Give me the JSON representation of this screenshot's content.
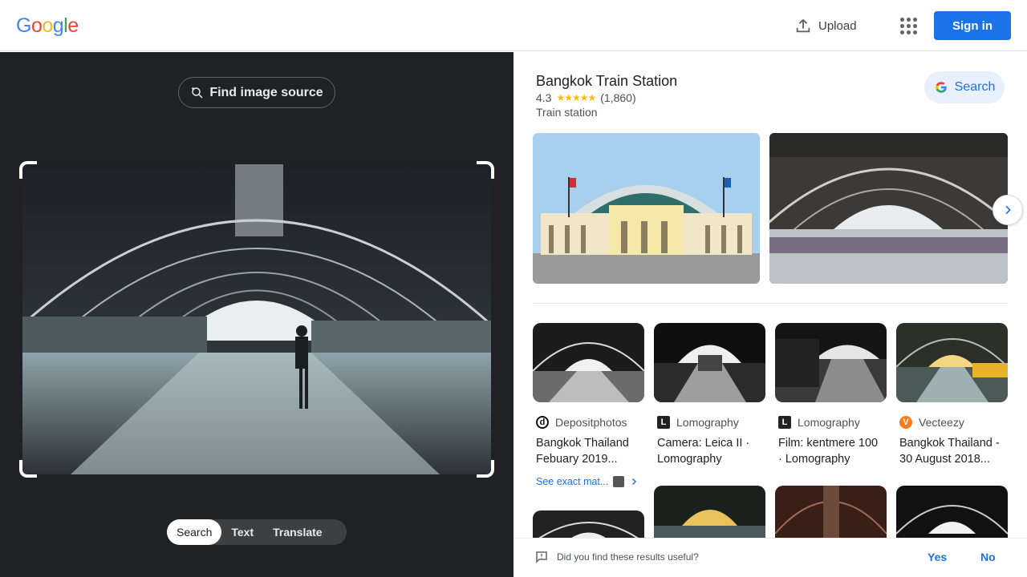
{
  "header": {
    "logo": {
      "letters": [
        "G",
        "o",
        "o",
        "g",
        "l",
        "e"
      ],
      "colors": [
        "#4285F4",
        "#EA4335",
        "#FBBC05",
        "#4285F4",
        "#34A853",
        "#EA4335"
      ]
    },
    "upload_label": "Upload",
    "signin_label": "Sign in"
  },
  "lens": {
    "find_source_label": "Find image source",
    "tabs": [
      {
        "label": "Search",
        "active": true
      },
      {
        "label": "Text",
        "active": false
      },
      {
        "label": "Translate",
        "active": false
      }
    ]
  },
  "knowledge_panel": {
    "title": "Bangkok Train Station",
    "rating": "4.3",
    "stars": "★★★★★",
    "review_count": "(1,860)",
    "category": "Train station",
    "search_label": "Search"
  },
  "results": [
    {
      "source": "Depositphotos",
      "title_line1": "Bangkok Thailand",
      "title_line2": "Febuary 2019...",
      "favicon": "d",
      "favicon_color": "#111"
    },
    {
      "source": "Lomography",
      "title_line1": "Camera: Leica II ·",
      "title_line2": "Lomography",
      "favicon": "L",
      "favicon_color": "#222"
    },
    {
      "source": "Lomography",
      "title_line1": "Film: kentmere 100",
      "title_line2": "· Lomography",
      "favicon": "L",
      "favicon_color": "#222"
    },
    {
      "source": "Vecteezy",
      "title_line1": "Bangkok Thailand -",
      "title_line2": "30 August 2018...",
      "favicon": "V",
      "favicon_color": "#ff7a1a"
    }
  ],
  "see_exact_label": "See exact mat...",
  "feedback": {
    "question": "Did you find these results useful?",
    "yes_label": "Yes",
    "no_label": "No"
  },
  "colors": {
    "accent": "#1a73e8",
    "dark_panel": "#202124"
  }
}
